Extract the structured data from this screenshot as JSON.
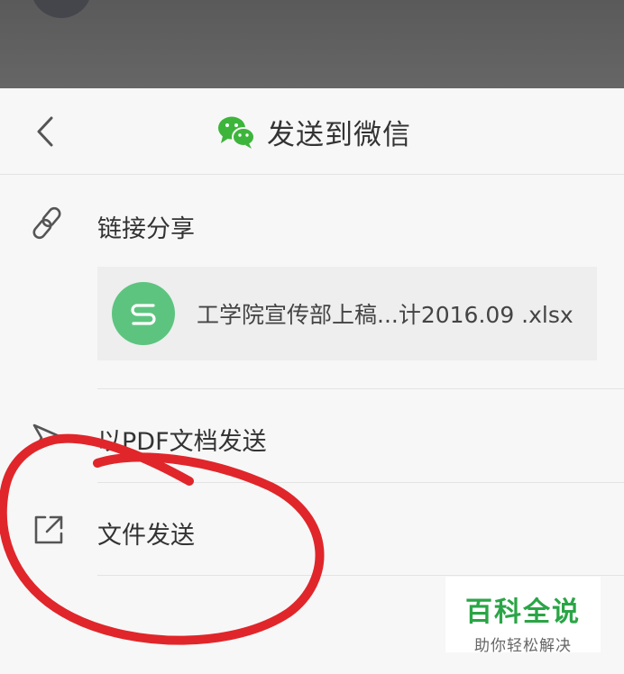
{
  "header": {
    "title": "发送到微信",
    "icons": {
      "back": "chevron-left-icon",
      "brand": "wechat-icon"
    }
  },
  "options": [
    {
      "id": "link-share",
      "label": "链接分享",
      "icon": "link-icon"
    },
    {
      "id": "pdf-send",
      "label": "以PDF文档发送",
      "icon": "send-arrow-icon"
    },
    {
      "id": "file-send",
      "label": "文件发送",
      "icon": "share-external-icon"
    }
  ],
  "file": {
    "name": "工学院宣传部上稿...计2016.09 .xlsx",
    "icon": "spreadsheet-s-icon",
    "icon_color": "#5dc47f"
  },
  "watermark": {
    "title": "百科全说",
    "subtitle": "助你轻松解决",
    "color": "#2aa546"
  },
  "colors": {
    "accent": "#5dc47f",
    "annotation": "#e0262a",
    "wechat": "#3db53b"
  }
}
